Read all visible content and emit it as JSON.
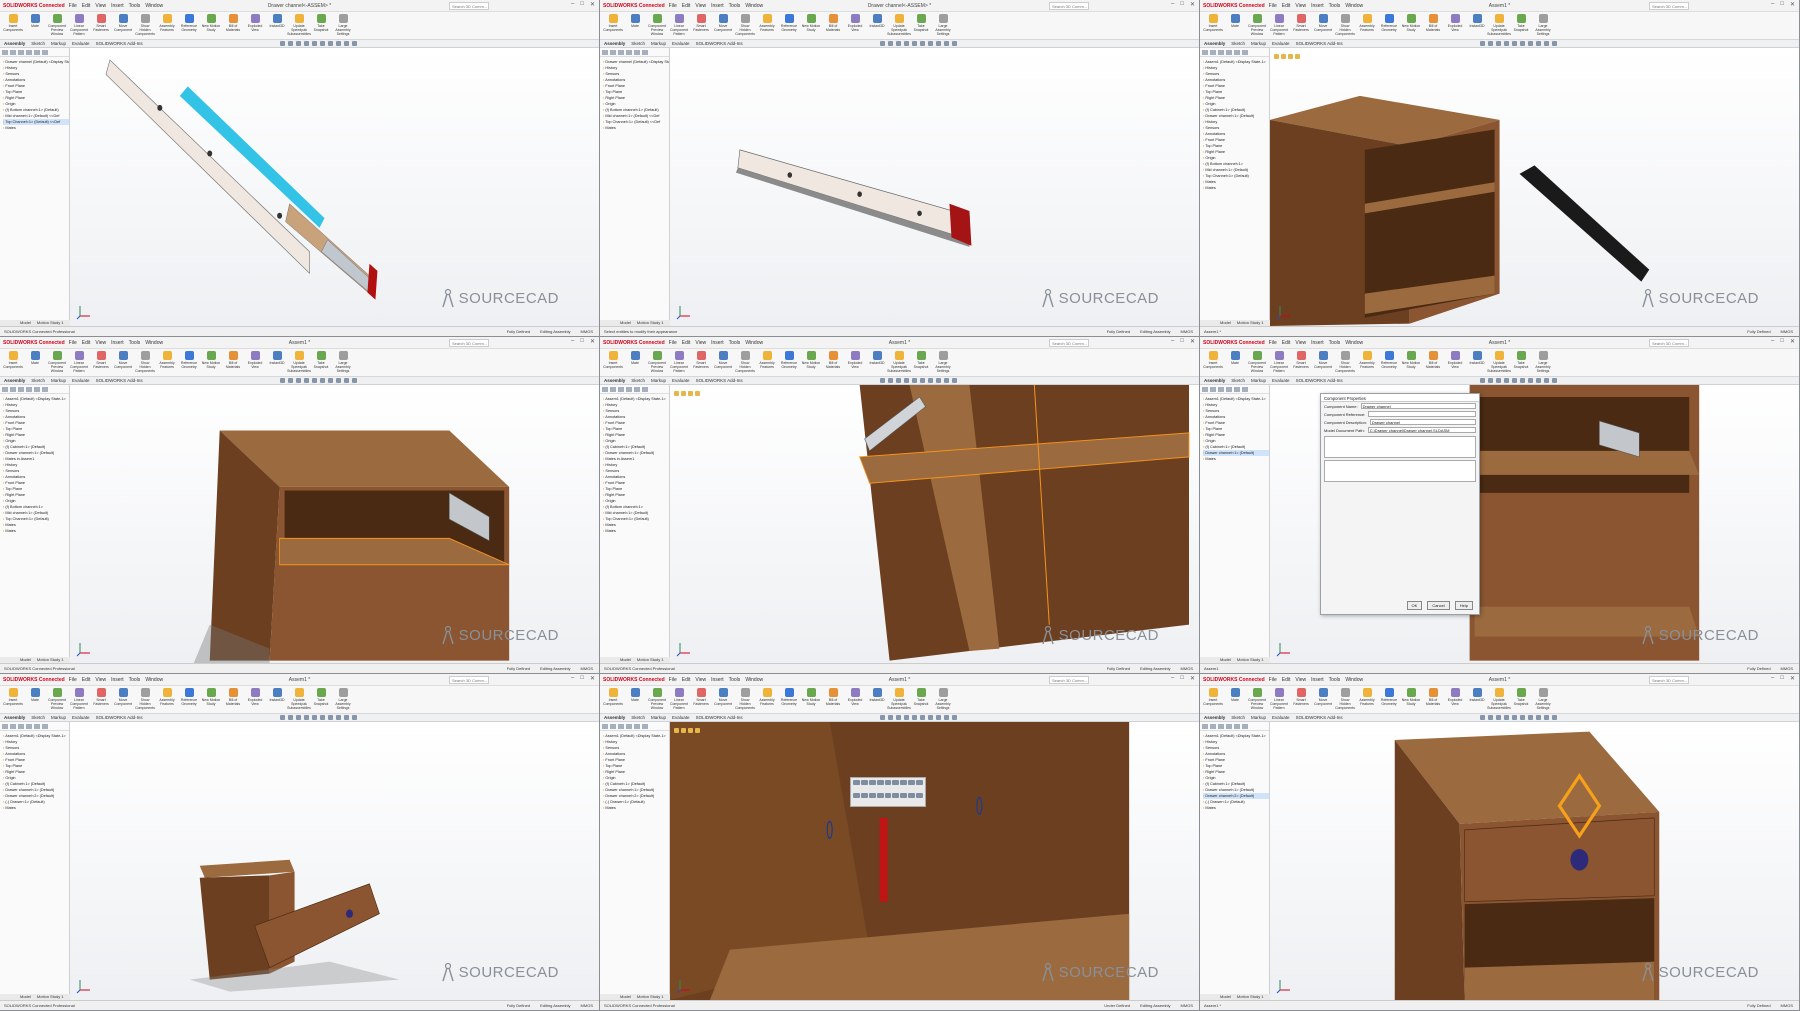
{
  "app": {
    "brand": "SOLIDWORKS Connected",
    "menu": [
      "File",
      "Edit",
      "View",
      "Insert",
      "Tools",
      "Window"
    ],
    "search_placeholder": "Search 3D Comm...",
    "ribbon_buttons": [
      "Insert Components",
      "Mate",
      "Component Preview Window",
      "Linear Component Pattern",
      "Smart Fasteners",
      "Move Component",
      "Show Hidden Components",
      "Assembly Features",
      "Reference Geometry",
      "New Motion Study",
      "Bill of Materials",
      "Exploded View",
      "Instant3D",
      "Update Speedpak Subassemblies",
      "Take Snapshot",
      "Large Assembly Settings"
    ],
    "command_tabs": [
      "Assembly",
      "Sketch",
      "Markup",
      "Evaluate",
      "SOLIDWORKS Add-Ins"
    ],
    "model_tabs": [
      "Model",
      "Motion Study 1"
    ],
    "watermark": "SOURCECAD",
    "accent": "#d0021b",
    "selection_color": "#f7941d"
  },
  "panels": [
    {
      "doc_title": "Drawer channel<-ASSEM> *",
      "tree": [
        "Drawer channel (Default) <Display State-1>",
        "History",
        "Sensors",
        "Annotations",
        "Front Plane",
        "Top Plane",
        "Right Plane",
        "Origin",
        "(f) Bottom channel<1> (Default)",
        "Mid channel<1> (Default) <<Def",
        "Top Channel<1> (Default) <<Def",
        "Mates"
      ],
      "tree_selected": 10,
      "status_left": "SOLIDWORKS Connected Professional",
      "status_right": [
        "Fully Defined",
        "Editing Assembly",
        "MMGS"
      ]
    },
    {
      "doc_title": "Drawer channel<-ASSEM> *",
      "tree": [
        "Drawer channel (Default) <Display State-1>",
        "History",
        "Sensors",
        "Annotations",
        "Front Plane",
        "Top Plane",
        "Right Plane",
        "Origin",
        "(f) Bottom channel<1> (Default)",
        "Mid channel<1> (Default) <<Def",
        "Top Channel<1> (Default) <<Def",
        "Mates"
      ],
      "tree_selected": -1,
      "status_left": "Select entities to modify their appearance",
      "status_right": [
        "Fully Defined",
        "Editing Assembly",
        "MMGS"
      ]
    },
    {
      "doc_title": "Assem1 *",
      "tree": [
        "Assem1 (Default) <Display State-1>",
        "History",
        "Sensors",
        "Annotations",
        "Front Plane",
        "Top Plane",
        "Right Plane",
        "Origin",
        "(f) Cabinet<1> (Default)",
        "Drawer channel<1> (Default)",
        "History",
        "Sensors",
        "Annotations",
        "Front Plane",
        "Top Plane",
        "Right Plane",
        "Origin",
        "(f) Bottom channel<1>",
        "Mid channel<1> (Default)",
        "Top Channel<1> (Default)",
        "Mates",
        "Mates"
      ],
      "tree_selected": -1,
      "status_left": "Assem1 *",
      "status_right": [
        "Fully Defined",
        "MMGS"
      ]
    },
    {
      "doc_title": "Assem1 *",
      "tree": [
        "Assem1 (Default) <Display State-1>",
        "History",
        "Sensors",
        "Annotations",
        "Front Plane",
        "Top Plane",
        "Right Plane",
        "Origin",
        "(f) Cabinet<1> (Default)",
        "Drawer channel<1> (Default)",
        "Mates in Assem1",
        "History",
        "Sensors",
        "Annotations",
        "Front Plane",
        "Top Plane",
        "Right Plane",
        "Origin",
        "(f) Bottom channel<1>",
        "Mid channel<1> (Default)",
        "Top Channel<1> (Default)",
        "Mates",
        "Mates"
      ],
      "tree_selected": -1,
      "status_left": "SOLIDWORKS Connected Professional",
      "status_right": [
        "Fully Defined",
        "Editing Assembly",
        "MMGS"
      ]
    },
    {
      "doc_title": "Assem1 *",
      "tree": [
        "Assem1 (Default) <Display State-1>",
        "History",
        "Sensors",
        "Annotations",
        "Front Plane",
        "Top Plane",
        "Right Plane",
        "Origin",
        "(f) Cabinet<1> (Default)",
        "Drawer channel<1> (Default)",
        "Mates in Assem1",
        "History",
        "Sensors",
        "Annotations",
        "Front Plane",
        "Top Plane",
        "Right Plane",
        "Origin",
        "(f) Bottom channel<1>",
        "Mid channel<1> (Default)",
        "Top Channel<1> (Default)",
        "Mates",
        "Mates"
      ],
      "tree_selected": -1,
      "status_left": "SOLIDWORKS Connected Professional",
      "status_right": [
        "Fully Defined",
        "Editing Assembly",
        "MMGS"
      ]
    },
    {
      "doc_title": "Assem1 *",
      "tree": [
        "Assem1 (Default) <Display State-1>",
        "History",
        "Sensors",
        "Annotations",
        "Front Plane",
        "Top Plane",
        "Right Plane",
        "Origin",
        "(f) Cabinet<1> (Default)",
        "Drawer channel<1> (Default)",
        "Mates"
      ],
      "tree_selected": 9,
      "status_left": "Assem1",
      "status_right": [
        "Fully Defined",
        "MMGS"
      ],
      "dialog": {
        "title": "Component Properties",
        "fields": [
          {
            "label": "Component Name:",
            "value": "Drawer channel"
          },
          {
            "label": "Component Reference:",
            "value": ""
          },
          {
            "label": "Component Description:",
            "value": "Drawer channel"
          },
          {
            "label": "Model Document Path:",
            "value": "C:\\Drawer channel\\Drawer channel.SLDASM"
          }
        ],
        "buttons": [
          "OK",
          "Cancel",
          "Help"
        ]
      }
    },
    {
      "doc_title": "Assem1 *",
      "tree": [
        "Assem1 (Default) <Display State-1>",
        "History",
        "Sensors",
        "Annotations",
        "Front Plane",
        "Top Plane",
        "Right Plane",
        "Origin",
        "(f) Cabinet<1> (Default)",
        "Drawer channel<1> (Default)",
        "Drawer channel<2> (Default)",
        "(-) Drawer<1> (Default)",
        "Mates"
      ],
      "tree_selected": -1,
      "status_left": "SOLIDWORKS Connected Professional",
      "status_right": [
        "Fully Defined",
        "Editing Assembly",
        "MMGS"
      ]
    },
    {
      "doc_title": "Assem1 *",
      "tree": [
        "Assem1 (Default) <Display State-1>",
        "History",
        "Sensors",
        "Annotations",
        "Front Plane",
        "Top Plane",
        "Right Plane",
        "Origin",
        "(f) Cabinet<1> (Default)",
        "Drawer channel<1> (Default)",
        "Drawer channel<2> (Default)",
        "(-) Drawer<1> (Default)",
        "Mates"
      ],
      "tree_selected": -1,
      "status_left": "SOLIDWORKS Connected Professional",
      "status_right": [
        "Under Defined",
        "Editing Assembly",
        "MMGS"
      ]
    },
    {
      "doc_title": "Assem1 *",
      "tree": [
        "Assem1 (Default) <Display State-1>",
        "History",
        "Sensors",
        "Annotations",
        "Front Plane",
        "Top Plane",
        "Right Plane",
        "Origin",
        "(f) Cabinet<1> (Default)",
        "Drawer channel<1> (Default)",
        "Drawer channel<2> (Default)",
        "(-) Drawer<1> (Default)",
        "Mates"
      ],
      "tree_selected": 10,
      "status_left": "Assem1 *",
      "status_right": [
        "Fully Defined",
        "MMGS"
      ]
    }
  ]
}
